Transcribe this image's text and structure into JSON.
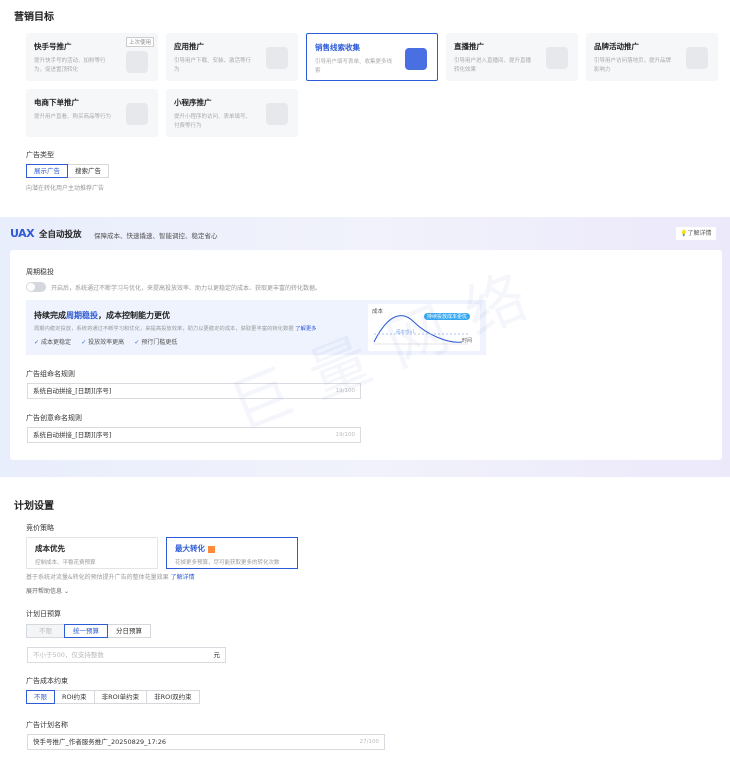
{
  "marketing": {
    "title": "营销目标",
    "cards": [
      {
        "title": "快手号推广",
        "desc": "提升快手号的活动、加粉等行为，促进置顶转化",
        "tag": "上次使用"
      },
      {
        "title": "应用推广",
        "desc": "引导用户下载、安装、激活等行为"
      },
      {
        "title": "销售线索收集",
        "desc": "引导用户填写表单、收集更多线索"
      },
      {
        "title": "直播推广",
        "desc": "引导用户进入直播间、提升直播转化效果"
      },
      {
        "title": "品牌活动推广",
        "desc": "引导用户访问落地页，提升品牌影响力"
      },
      {
        "title": "电商下单推广",
        "desc": "提升用户直看、购买商品等行为"
      },
      {
        "title": "小程序推广",
        "desc": "提升小程序的访问、表单填写、付费等行为"
      }
    ],
    "ad_type_label": "广告类型",
    "ad_types": [
      "展示广告",
      "搜索广告"
    ],
    "ad_type_hint": "向潜在转化用户主动推荐广告"
  },
  "uax": {
    "logo": "UAX",
    "title": "全自动投放",
    "subtitle": "保障成本、快速撬速、智能调控、稳定省心",
    "learn_more": "了解详情",
    "cycle_label": "周期稳投",
    "cycle_hint": "开启后，系统通过不断学习与优化，来提高投放效率、助力以更稳定的成本、获取更丰富的转化数据。",
    "promo_title_pre": "持续完成",
    "promo_title_em": "周期稳投",
    "promo_title_post": "，成本控制能力更优",
    "promo_desc": "周期内稳定投放，系统将通过不断学习和优化，来提高投放效率，助力以更稳定的成本，获取更丰富的转化数据",
    "promo_link": "了解更多",
    "checks": [
      "成本更稳定",
      "投放效率更高",
      "预行门槛更低"
    ],
    "chart_cost": "成本",
    "chart_time": "时间",
    "chart_badge": "持续投放成本更优",
    "chart_target": "成本线x1",
    "group_rule_label": "广告组命名规则",
    "group_rule_value": "系统自动拼接_[日期][序号]",
    "group_rule_count": "19/100",
    "creative_rule_label": "广告创意命名规则",
    "creative_rule_value": "系统自动拼接_[日期][序号]",
    "creative_rule_count": "19/100",
    "watermark": "巨量网络"
  },
  "plan": {
    "title": "计划设置",
    "bid_label": "竞价策略",
    "bids": [
      {
        "title": "成本优先",
        "desc": "控制成本、平稳花费预算"
      },
      {
        "title": "最大转化",
        "desc": "花掉更多预算，尽可能获取更多的转化次数"
      }
    ],
    "bid_hint_pre": "基于系统对流量&转化的预估提升广告的整体花量效果",
    "bid_hint_link": "了解详情",
    "expand": "展开帮助信息",
    "budget_label": "计划日预算",
    "budget_opts": [
      "不限",
      "统一预算",
      "分日预算"
    ],
    "budget_placeholder": "不小于500，仅支持整数",
    "budget_unit": "元",
    "cost_label": "广告成本约束",
    "cost_opts": [
      "不限",
      "ROI约束",
      "非ROI单约束",
      "非ROI双约束"
    ],
    "name_label": "广告计划名称",
    "name_value": "快手号推广_作者服务推广_20250829_17:26",
    "name_count": "27/100"
  }
}
